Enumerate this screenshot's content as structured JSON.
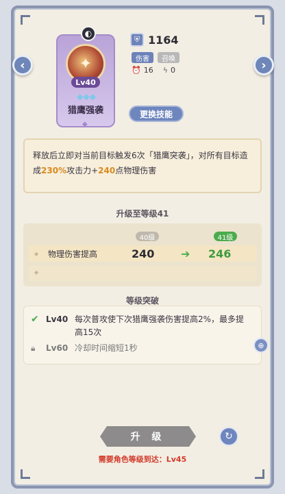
{
  "colors": {
    "highlight": "#d98a1e",
    "green": "#4bab4d",
    "red": "#d23a2a",
    "accent": "#6e86bd"
  },
  "nav": {
    "left_icon": "chevron-left-icon",
    "right_icon": "chevron-right-icon",
    "left_glyph": "‹",
    "right_glyph": "›"
  },
  "skill": {
    "level": "Lv40",
    "name": "猎鹰强袭",
    "stars": "◆◆◆",
    "power": "1164",
    "tags": [
      "伤害",
      "召唤"
    ],
    "cooldown": "16",
    "energy": "0",
    "change_label": "更换技能"
  },
  "description": {
    "part1": "释放后立即对当前目标触发6次「猎鹰突袭」，对所有目标造成",
    "percent": "230%",
    "part2": "攻击力+",
    "flat": "240",
    "part3": "点物理伤害"
  },
  "upgrade": {
    "title": "升级至等级41",
    "from_level": "40级",
    "to_level": "41级",
    "stat_label": "物理伤害提高",
    "from_value": "240",
    "to_value": "246"
  },
  "breakthrough": {
    "title": "等级突破",
    "items": [
      {
        "level": "Lv40",
        "text": "每次普攻使下次猎鹰强袭伤害提高2%，最多提高15次",
        "unlocked": true
      },
      {
        "level": "Lv60",
        "text": "冷却时间缩短1秒",
        "unlocked": false
      }
    ]
  },
  "actions": {
    "upgrade_label": "升 级",
    "requirement": "需要角色等级到达：Lv45"
  }
}
